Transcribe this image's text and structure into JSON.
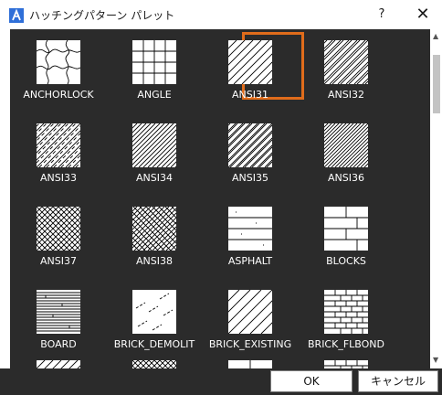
{
  "window": {
    "title": "ハッチングパターン パレット",
    "help_label": "?",
    "close_label": "✕"
  },
  "patterns": [
    {
      "name": "ANCHORLOCK",
      "kind": "anchorlock"
    },
    {
      "name": "ANGLE",
      "kind": "angle"
    },
    {
      "name": "ANSI31",
      "kind": "ansi31",
      "selected": true
    },
    {
      "name": "ANSI32",
      "kind": "ansi32"
    },
    {
      "name": "ANSI33",
      "kind": "ansi33"
    },
    {
      "name": "ANSI34",
      "kind": "ansi34"
    },
    {
      "name": "ANSI35",
      "kind": "ansi35"
    },
    {
      "name": "ANSI36",
      "kind": "ansi36"
    },
    {
      "name": "ANSI37",
      "kind": "ansi37"
    },
    {
      "name": "ANSI38",
      "kind": "ansi38"
    },
    {
      "name": "ASPHALT",
      "kind": "asphalt"
    },
    {
      "name": "BLOCKS",
      "kind": "blocks"
    },
    {
      "name": "BOARD",
      "kind": "board"
    },
    {
      "name": "BRICK_DEMOLIT",
      "kind": "demolit"
    },
    {
      "name": "BRICK_EXISTING",
      "kind": "existing"
    },
    {
      "name": "BRICK_FLBOND",
      "kind": "flbond"
    }
  ],
  "buttons": {
    "ok": "OK",
    "cancel": "キャンセル"
  },
  "colors": {
    "background": "#2b2b2b",
    "selection": "#e06c1b",
    "swatch_fill": "#ffffff",
    "swatch_stroke": "#000000"
  }
}
